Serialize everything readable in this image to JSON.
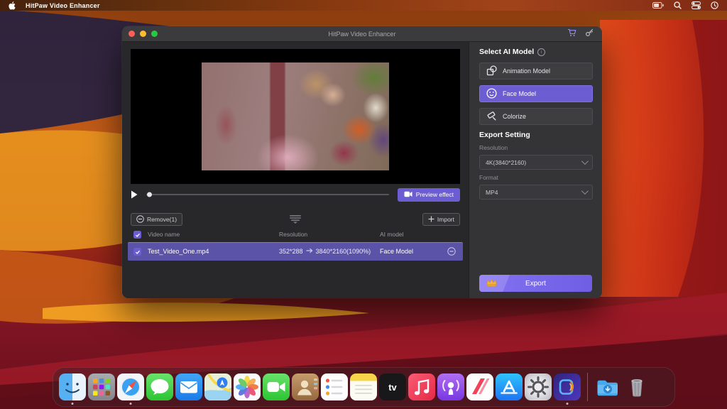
{
  "menu_bar": {
    "app_name": "HitPaw Video Enhancer",
    "status_icons": [
      "battery-icon",
      "spotlight-icon",
      "control-center-icon",
      "clock-icon"
    ]
  },
  "window": {
    "title": "HitPaw Video Enhancer",
    "titlebar_icons": [
      "cart-icon",
      "key-icon"
    ],
    "player": {
      "preview_button": "Preview effect"
    },
    "list": {
      "remove_button": "Remove(1)",
      "import_button": "Import",
      "columns": [
        "Video name",
        "Resolution",
        "AI model"
      ],
      "rows": [
        {
          "video_name": "Test_Video_One.mp4",
          "resolution_from": "352*288",
          "resolution_to": "3840*2160(1090%)",
          "ai_model": "Face Model",
          "checked": true,
          "selected": true
        }
      ]
    },
    "panel": {
      "select_title": "Select AI Model",
      "models": [
        {
          "label": "Animation Model",
          "icon": "animation-model-icon",
          "selected": false
        },
        {
          "label": "Face Model",
          "icon": "face-model-icon",
          "selected": true
        },
        {
          "label": "Colorize",
          "icon": "colorize-icon",
          "selected": false
        }
      ],
      "export_title": "Export Setting",
      "resolution_label": "Resolution",
      "resolution_value": "4K(3840*2160)",
      "format_label": "Format",
      "format_value": "MP4",
      "export_button": "Export"
    }
  },
  "dock": {
    "items": [
      {
        "name": "Finder",
        "running": true
      },
      {
        "name": "Launchpad",
        "running": false
      },
      {
        "name": "Safari",
        "running": true
      },
      {
        "name": "Messages",
        "running": false
      },
      {
        "name": "Mail",
        "running": false
      },
      {
        "name": "Maps",
        "running": false
      },
      {
        "name": "Photos",
        "running": false
      },
      {
        "name": "FaceTime",
        "running": false
      },
      {
        "name": "Contacts",
        "running": false
      },
      {
        "name": "Reminders",
        "running": false
      },
      {
        "name": "Notes",
        "running": false
      },
      {
        "name": "Apple TV",
        "running": false
      },
      {
        "name": "Music",
        "running": false
      },
      {
        "name": "Podcasts",
        "running": false
      },
      {
        "name": "News",
        "running": false
      },
      {
        "name": "App Store",
        "running": false
      },
      {
        "name": "System Settings",
        "running": false
      },
      {
        "name": "HitPaw Video Enhancer",
        "running": true
      },
      {
        "name": "Downloads",
        "running": false
      },
      {
        "name": "Trash",
        "running": false
      }
    ]
  },
  "colors": {
    "accent": "#6C5DD3",
    "selected_row": "#5B53A8",
    "window_bg": "#29292B",
    "panel_bg": "#343437",
    "titlebar_bg": "#3B3B3D",
    "export_gradient": "#8472F2"
  }
}
